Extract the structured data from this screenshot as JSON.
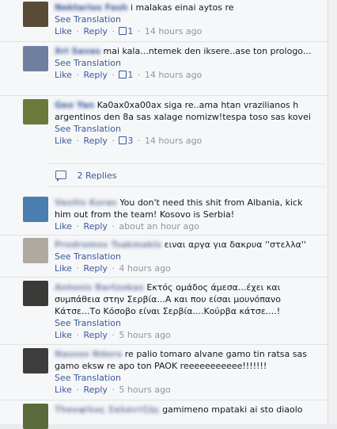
{
  "labels": {
    "see_translation": "See Translation",
    "like": "Like",
    "reply": "Reply",
    "dot": "·"
  },
  "comments": [
    {
      "name": "Nektarios Fash",
      "text": "i malakas einai aytos re",
      "likes": "1",
      "time": "14 hours ago",
      "see_translation": true,
      "avatar_color": "#5a4a38"
    },
    {
      "name": "Xri Savas",
      "text": "mai kala...ntemek den iksere..ase ton prologo...",
      "likes": "1",
      "time": "14 hours ago",
      "see_translation": true,
      "avatar_color": "#6e7fa0"
    },
    {
      "name": "Geo Yan",
      "text": "Ka0ax0xa00ax siga re..ama htan vrazilianos h argentinos den 8a sas xalage nomizw!tespa toso sas kovei",
      "likes": "3",
      "time": "14 hours ago",
      "see_translation": true,
      "avatar_color": "#6a7a3a"
    },
    {
      "name": "Vasilis Koras",
      "text": "You don't need this shit from Albania, kick him out from the team! Kosovo is Serbia!",
      "likes": "",
      "time": "about an hour ago",
      "see_translation": false,
      "avatar_color": "#4a7eb0"
    },
    {
      "name": "Prodromos Tsakmakis",
      "text": "ειναι αργα για δακρυα ''στελλα''",
      "likes": "",
      "time": "4 hours ago",
      "see_translation": true,
      "avatar_color": "#b0a9a0"
    },
    {
      "name": "Antonis Bartzokas",
      "text": "Εκτός ομάδος άμεσα...έχει και συμπάθεια στην Σερβία...Α και που είσαι μουνόπανο Κάτσε...Το Κόσοβο είναι Σερβία....Κούρβα κάτσε....!",
      "likes": "",
      "time": "5 hours ago",
      "see_translation": true,
      "avatar_color": "#3a3a38"
    },
    {
      "name": "Nassos Ndoro",
      "text": "re palio tomaro alvane gamo tin ratsa sas gamo eksw re apo ton PAOK reeeeeeeeeee!!!!!!!",
      "likes": "",
      "time": "5 hours ago",
      "see_translation": true,
      "avatar_color": "#3d3d3d"
    },
    {
      "name": "Theoφiλος Σαλαντζής",
      "text": "gamimeno mpataki ai sto diaolo",
      "likes": "",
      "time": "",
      "see_translation": false,
      "avatar_color": "#5a6a3a"
    }
  ],
  "replies": {
    "label": "2 Replies"
  }
}
